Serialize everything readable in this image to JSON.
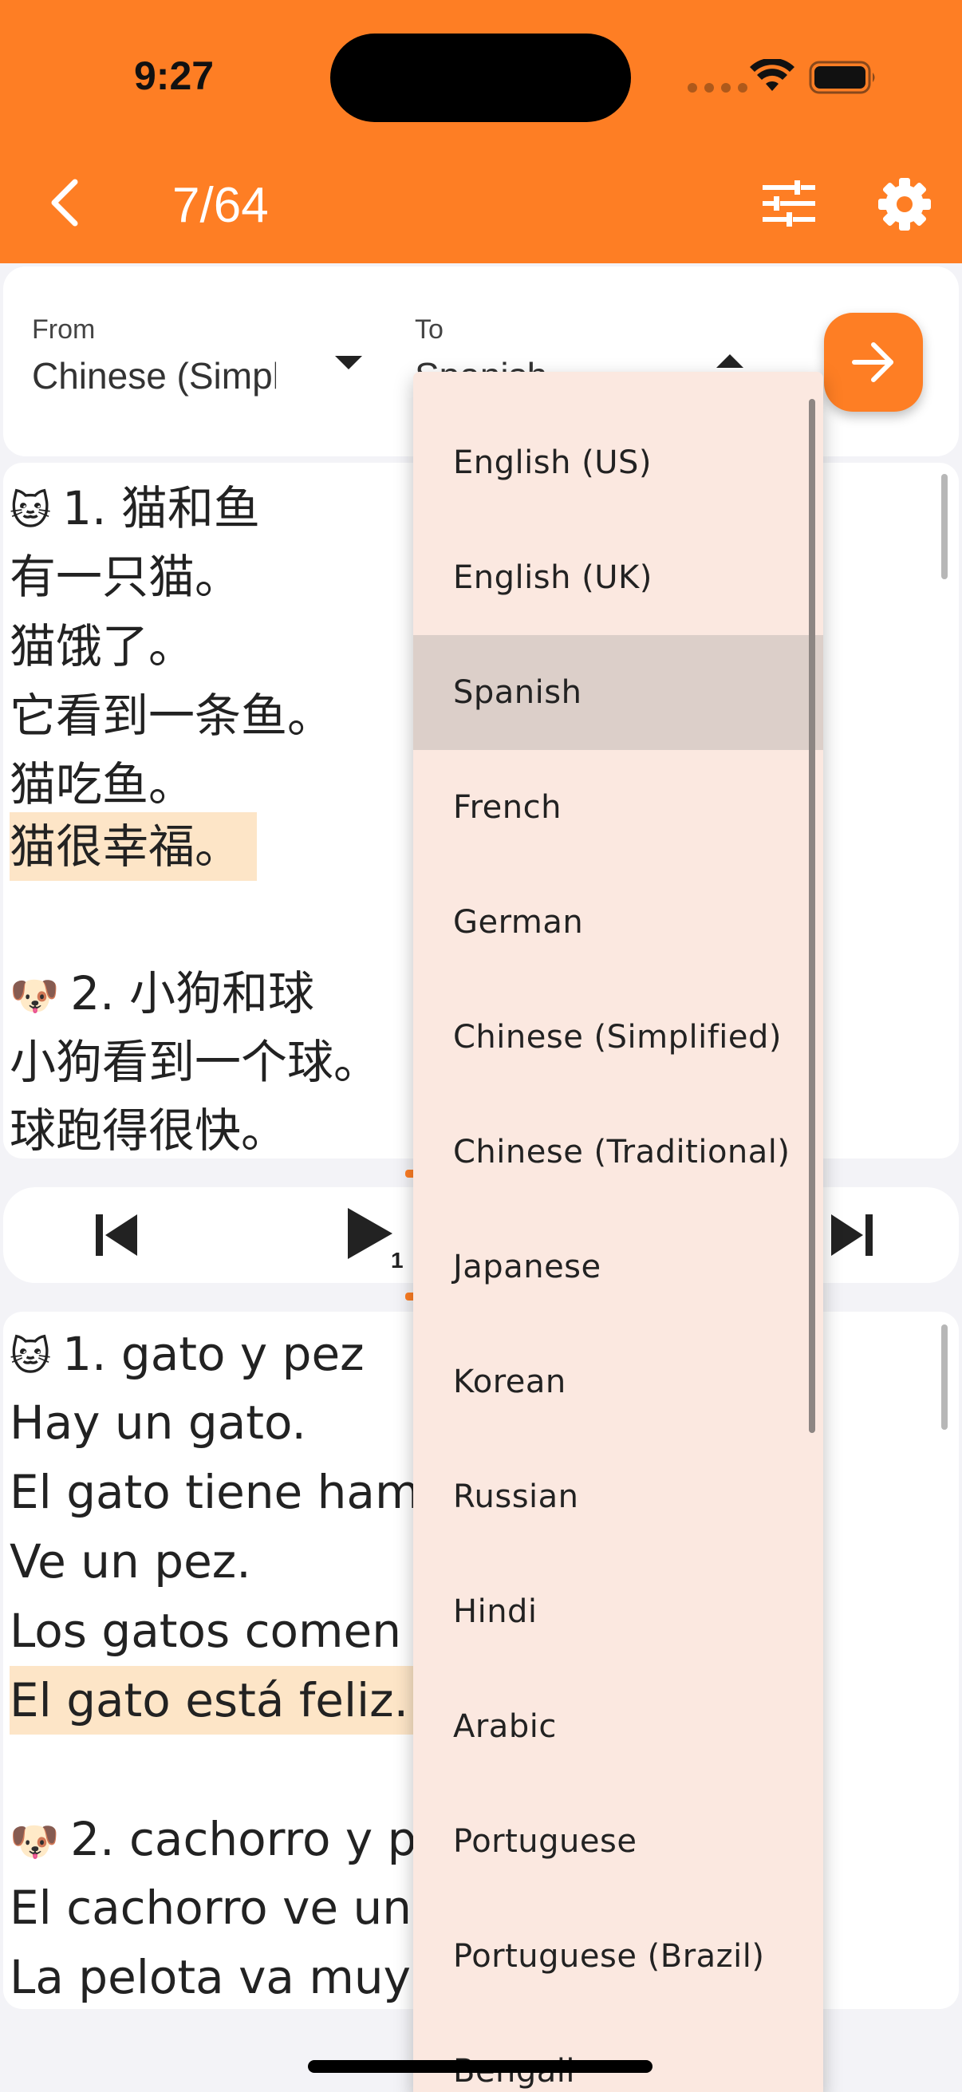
{
  "status_bar": {
    "time": "9:27"
  },
  "app_bar": {
    "page_counter": "7/64"
  },
  "language_selector": {
    "from_label": "From",
    "from_value": "Chinese (Simplified)",
    "to_label": "To",
    "to_value": "Spanish"
  },
  "source_text": {
    "lines": [
      {
        "emoji": "🐱",
        "text": "1. 猫和鱼"
      },
      {
        "text": "有一只猫。"
      },
      {
        "text": "猫饿了。"
      },
      {
        "text": "它看到一条鱼。"
      },
      {
        "text": "猫吃鱼。"
      },
      {
        "text": "猫很幸福。",
        "highlighted": true
      },
      {
        "text": ""
      },
      {
        "emoji": "🐶",
        "text": "2. 小狗和球"
      },
      {
        "text": "小狗看到一个球。"
      },
      {
        "text": "球跑得很快。"
      }
    ]
  },
  "player": {
    "speed_label": "1"
  },
  "target_text": {
    "lines": [
      {
        "emoji": "🐱",
        "text": "1. gato y pez"
      },
      {
        "text": "Hay un gato."
      },
      {
        "text": "El gato tiene ham"
      },
      {
        "text": "Ve un pez."
      },
      {
        "text": "Los gatos comen"
      },
      {
        "text": "El gato está feliz.",
        "highlighted": true
      },
      {
        "text": ""
      },
      {
        "emoji": "🐶",
        "text": "2. cachorro y p"
      },
      {
        "text": "El cachorro ve un"
      },
      {
        "text": "La pelota va muy"
      }
    ]
  },
  "dropdown": {
    "selected": "Spanish",
    "options": [
      "English (US)",
      "English (UK)",
      "Spanish",
      "French",
      "German",
      "Chinese (Simplified)",
      "Chinese (Traditional)",
      "Japanese",
      "Korean",
      "Russian",
      "Hindi",
      "Arabic",
      "Portuguese",
      "Portuguese (Brazil)",
      "Bengali"
    ]
  },
  "colors": {
    "accent": "#fe7e24",
    "highlight": "#fde5c7",
    "dropdown_bg": "#fbe8e0",
    "dropdown_selected": "#dccfc9"
  }
}
